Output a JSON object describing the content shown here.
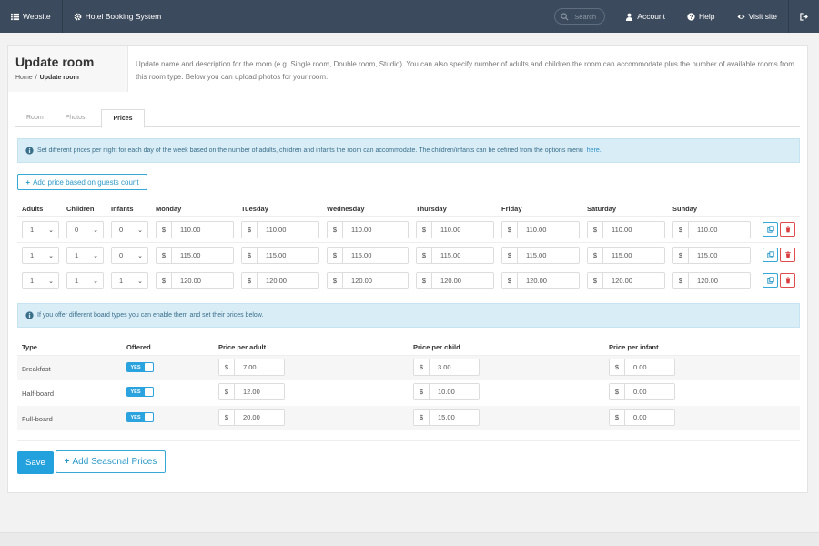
{
  "nav": {
    "website": "Website",
    "app_name": "Hotel Booking System",
    "search_placeholder": "Search",
    "account": "Account",
    "help": "Help",
    "visit_site": "Visit site"
  },
  "header": {
    "title": "Update room",
    "breadcrumb": {
      "home": "Home",
      "separator": "/",
      "current": "Update room"
    },
    "description": "Update name and description for the room (e.g. Single room, Double room, Studio). You can also specify number of adults and children the room can accommodate plus the number of available rooms from this room type. Below you can upload photos for your room."
  },
  "tabs": [
    "Room",
    "Photos",
    "Prices"
  ],
  "active_tab": "Prices",
  "prices": {
    "info": "Set different prices per night for each day of the week based on the number of adults, children and infants the room can accommodate. The children/infants can be defined from the options menu",
    "info_link": "here.",
    "add_button": "Add price based on guests count",
    "headers": [
      "Adults",
      "Children",
      "Infants",
      "Monday",
      "Tuesday",
      "Wednesday",
      "Thursday",
      "Friday",
      "Saturday",
      "Sunday"
    ],
    "currency": "$",
    "rows": [
      {
        "adults": "1",
        "children": "0",
        "infants": "0",
        "prices": [
          "110.00",
          "110.00",
          "110.00",
          "110.00",
          "110.00",
          "110.00",
          "110.00"
        ]
      },
      {
        "adults": "1",
        "children": "1",
        "infants": "0",
        "prices": [
          "115.00",
          "115.00",
          "115.00",
          "115.00",
          "115.00",
          "115.00",
          "115.00"
        ]
      },
      {
        "adults": "1",
        "children": "1",
        "infants": "1",
        "prices": [
          "120.00",
          "120.00",
          "120.00",
          "120.00",
          "120.00",
          "120.00",
          "120.00"
        ]
      }
    ]
  },
  "board": {
    "info": "If you offer different board types you can enable them and set their prices below.",
    "headers": [
      "Type",
      "Offered",
      "Price per adult",
      "Price per child",
      "Price per infant"
    ],
    "rows": [
      {
        "type": "Breakfast",
        "offered": "YES",
        "adult": "7.00",
        "child": "3.00",
        "infant": "0.00"
      },
      {
        "type": "Half-board",
        "offered": "YES",
        "adult": "12.00",
        "child": "10.00",
        "infant": "0.00"
      },
      {
        "type": "Full-board",
        "offered": "YES",
        "adult": "20.00",
        "child": "15.00",
        "infant": "0.00"
      }
    ]
  },
  "actions": {
    "save": "Save",
    "add_seasonal": "Add Seasonal Prices"
  },
  "colors": {
    "navbar": "#3b4a5c",
    "primary": "#22a1dd",
    "info_bg": "#d9edf7",
    "danger": "#e04b4b"
  }
}
